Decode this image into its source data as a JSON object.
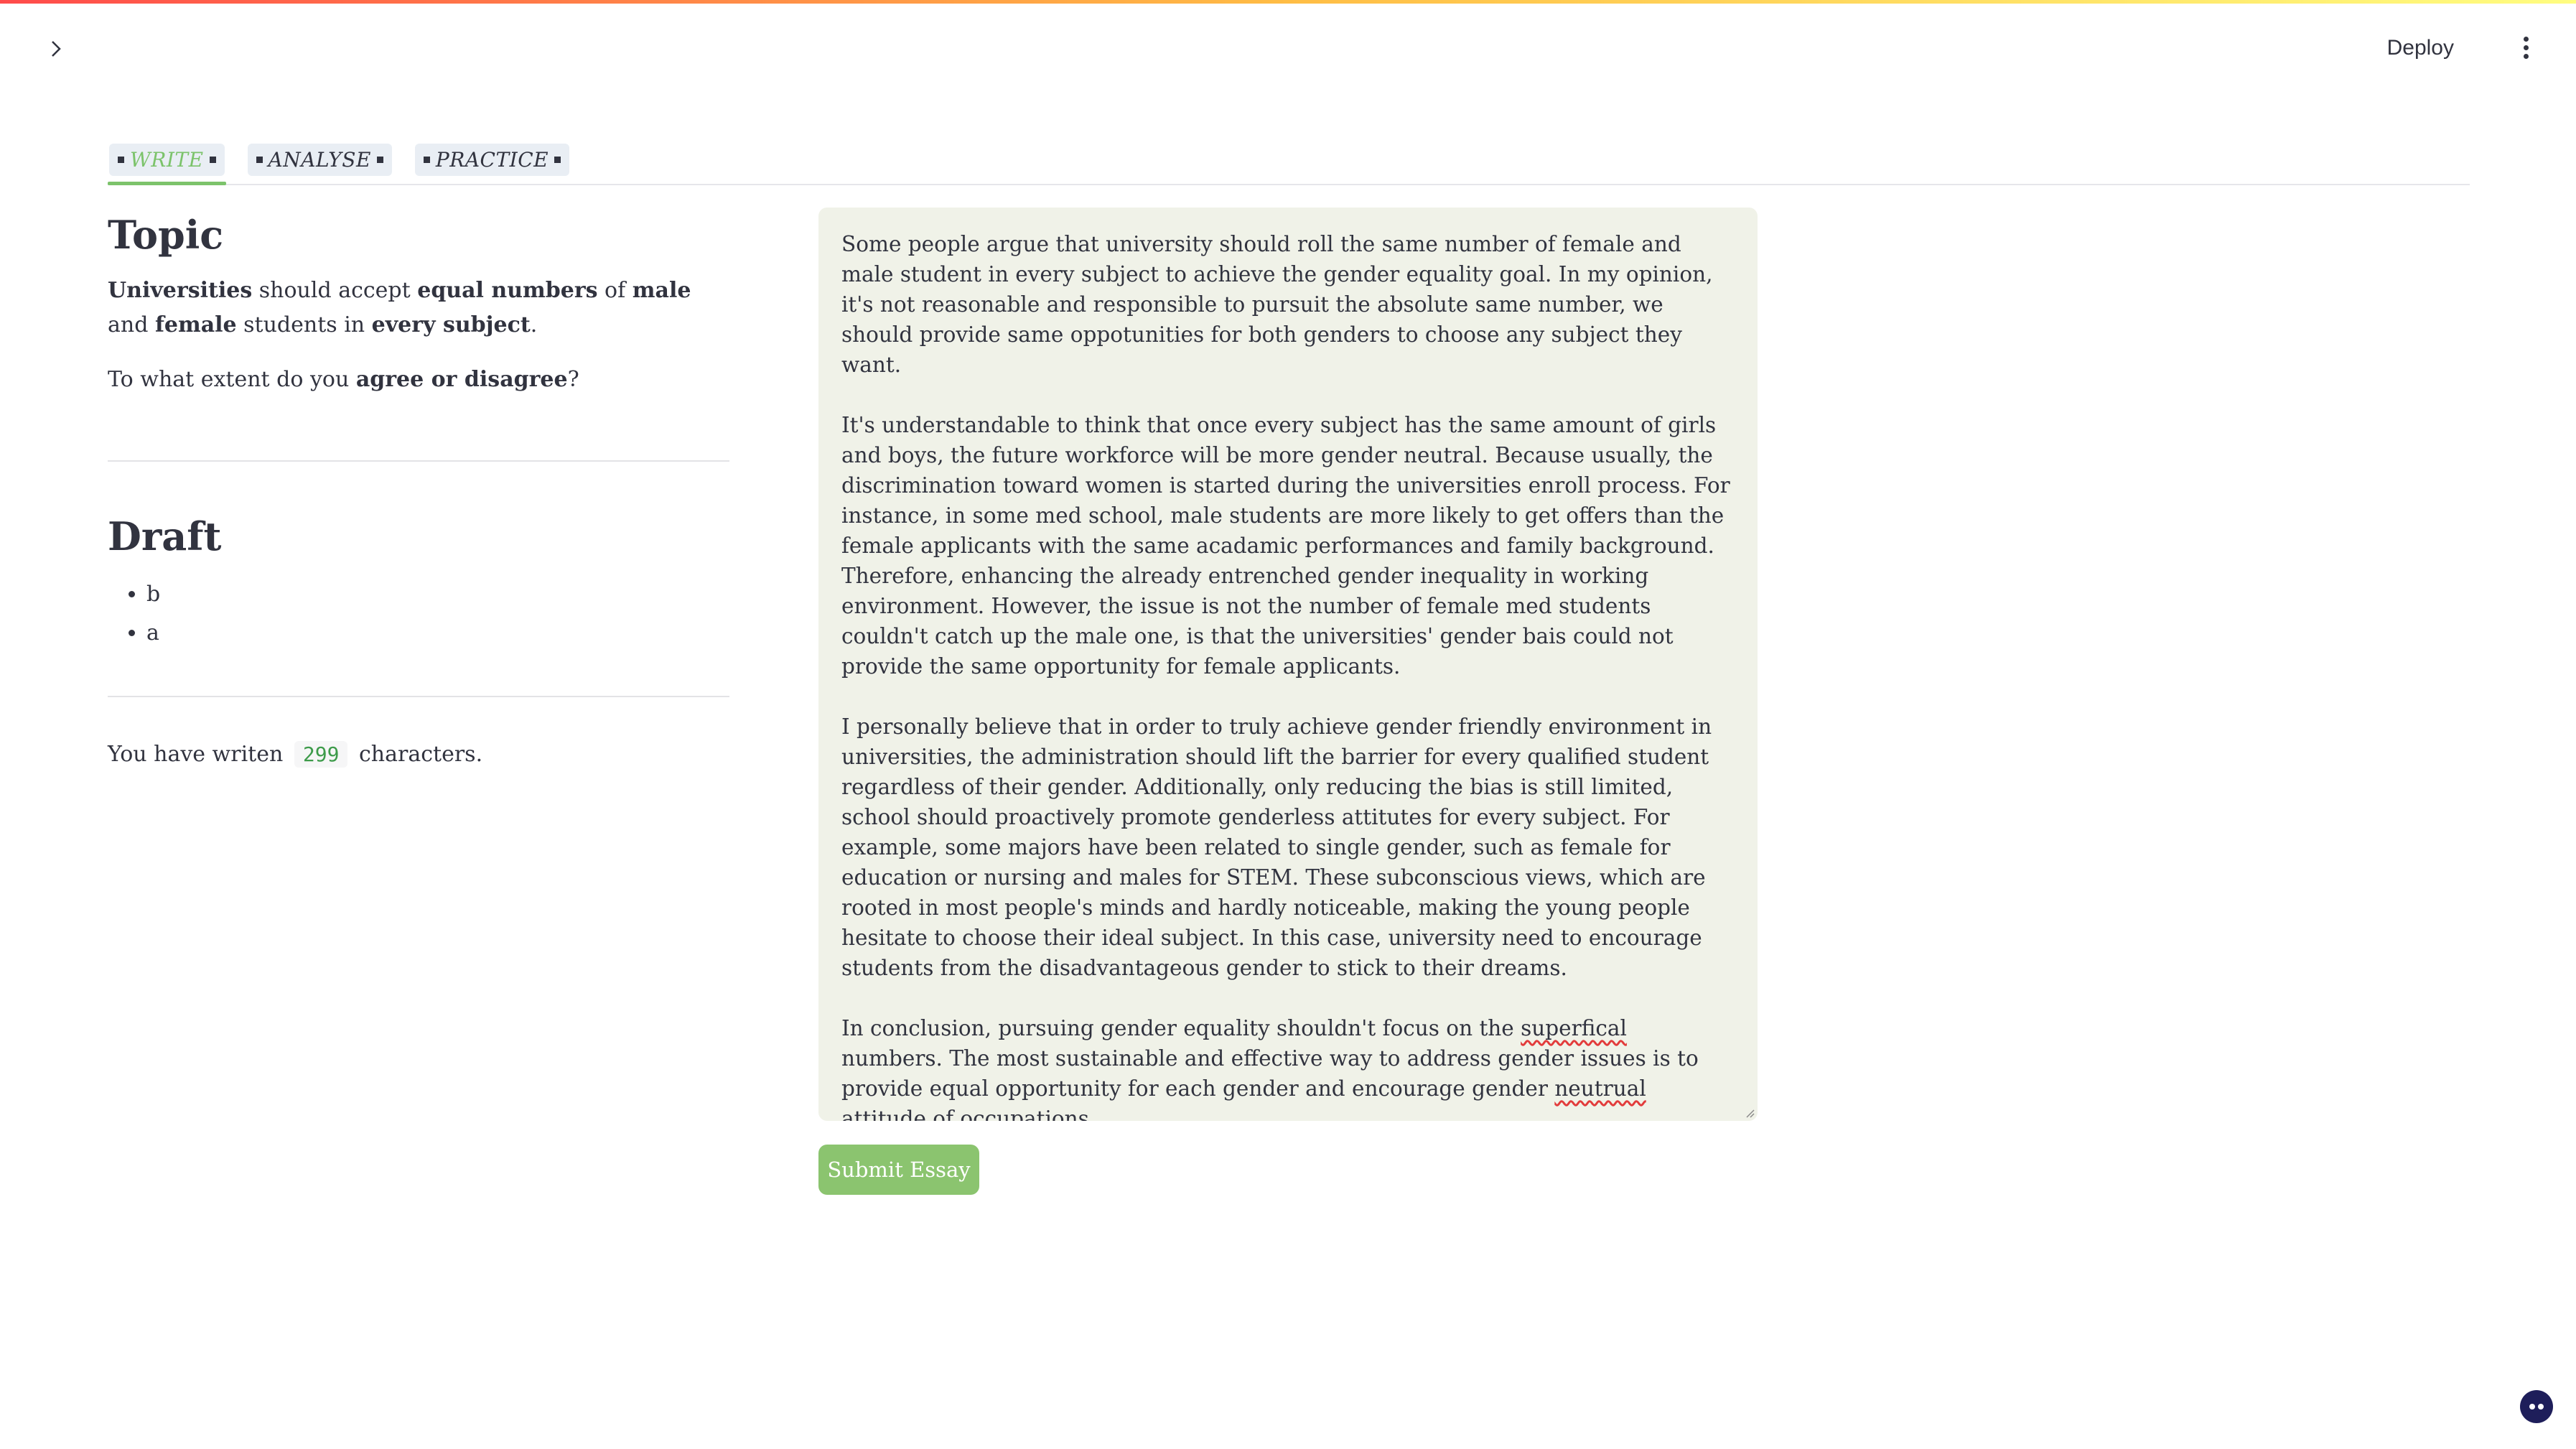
{
  "header": {
    "deploy_label": "Deploy"
  },
  "tabs": [
    {
      "label": "WRITE",
      "active": true
    },
    {
      "label": "ANALYSE",
      "active": false
    },
    {
      "label": "PRACTICE",
      "active": false
    }
  ],
  "topic": {
    "heading": "Topic",
    "statement": "Universities should accept equal numbers of male and female students in every subject.",
    "statement_parts": {
      "s1": "Universities",
      "s2": " should accept ",
      "s3": "equal numbers",
      "s4": " of ",
      "s5": "male",
      "s6": " and ",
      "s7": "female",
      "s8": " students in ",
      "s9": "every subject",
      "s10": "."
    },
    "question_parts": {
      "q1": "To what extent do you ",
      "q2": "agree or disagree",
      "q3": "?"
    }
  },
  "draft": {
    "heading": "Draft",
    "items": [
      "b",
      "a"
    ]
  },
  "count": {
    "prefix": "You have writen",
    "value": "299",
    "suffix": "characters."
  },
  "essay": {
    "p1": "Some people argue that university should roll the same number of female and male student in every subject to achieve the gender equality goal. In my opinion, it's not reasonable and responsible to pursuit the absolute same number, we should provide same oppotunities for both genders to choose any subject they want.",
    "p2": "It's understandable to think that once every subject has the same amount of girls and boys, the future workforce will be more gender neutral. Because usually, the discrimination toward women is started during the universities enroll process. For instance, in some med school, male students are more likely to get offers than the female applicants with the same acadamic performances and family background. Therefore, enhancing the already entrenched gender inequality in working environment. However, the issue is not the number of female med students couldn't catch up the male one, is that the universities' gender bais could not provide the same opportunity for female applicants.",
    "p3": "I personally believe that in order to truly achieve gender friendly environment in universities, the administration should lift the barrier for every qualified student regardless of their gender. Additionally, only reducing the bias is still limited, school should proactively promote genderless attitutes for every subject. For example, some majors have been related to single gender, such as female for education or nursing and males for STEM. These subconscious views, which are rooted in most people's minds and hardly noticeable, making the young people hesitate to choose their ideal subject. In this case, university need to encourage students from the disadvantageous gender to stick to their dreams.",
    "p4a": "In conclusion, pursuing gender equality shouldn't focus on the ",
    "p4b": "superfical",
    "p4c": " numbers. The most sustainable and effective way to address gender issues is to provide equal opportunity for each gender and encourage gender ",
    "p4d": "neutrual",
    "p4e": " attitude of occupations."
  },
  "submit_label": "Submit Essay",
  "colors": {
    "accent": "#7cc36b",
    "button": "#8bc46f",
    "essay_bg": "#f0f2e8"
  }
}
